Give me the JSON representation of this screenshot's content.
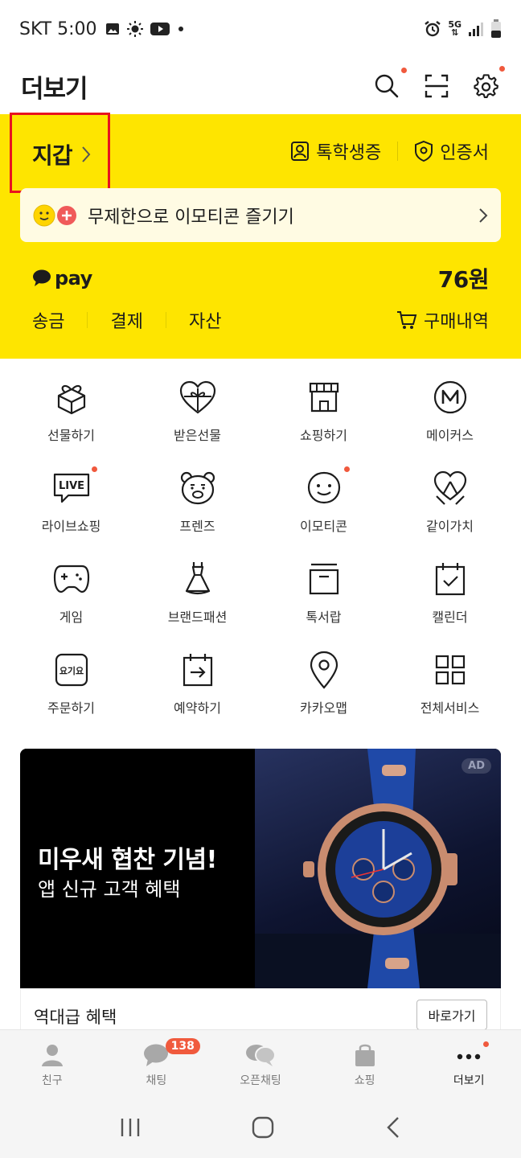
{
  "status_bar": {
    "carrier_time": "SKT 5:00",
    "network": "5G"
  },
  "header": {
    "title": "더보기"
  },
  "wallet": {
    "title": "지갑",
    "links": [
      {
        "label": "톡학생증",
        "icon": "student-id-icon"
      },
      {
        "label": "인증서",
        "icon": "certificate-icon"
      }
    ],
    "emoticon_banner": "무제한으로 이모티콘 즐기기",
    "pay": {
      "logo_text": "pay",
      "amount": "76원"
    },
    "pay_menu": [
      "송금",
      "결제",
      "자산"
    ],
    "purchase_history": "구매내역"
  },
  "services": [
    {
      "label": "선물하기",
      "icon": "gift-box-icon"
    },
    {
      "label": "받은선물",
      "icon": "received-gift-icon"
    },
    {
      "label": "쇼핑하기",
      "icon": "store-icon"
    },
    {
      "label": "메이커스",
      "icon": "makers-icon"
    },
    {
      "label": "라이브쇼핑",
      "icon": "live-icon"
    },
    {
      "label": "프렌즈",
      "icon": "friends-bear-icon"
    },
    {
      "label": "이모티콘",
      "icon": "emoticon-icon"
    },
    {
      "label": "같이가치",
      "icon": "heart-ribbon-icon"
    },
    {
      "label": "게임",
      "icon": "gamepad-icon"
    },
    {
      "label": "브랜드패션",
      "icon": "dress-icon"
    },
    {
      "label": "톡서랍",
      "icon": "drawer-icon"
    },
    {
      "label": "캘린더",
      "icon": "calendar-icon"
    },
    {
      "label": "주문하기",
      "icon": "order-icon",
      "icon_text": "요기요"
    },
    {
      "label": "예약하기",
      "icon": "reservation-icon"
    },
    {
      "label": "카카오맵",
      "icon": "map-pin-icon"
    },
    {
      "label": "전체서비스",
      "icon": "all-services-icon"
    }
  ],
  "ad": {
    "headline": "미우새  협찬 기념!",
    "subline": "앱 신규 고객 혜택",
    "badge": "AD",
    "caption": "역대급 혜택",
    "cta": "바로가기"
  },
  "tabs": [
    {
      "label": "친구",
      "icon": "person-icon"
    },
    {
      "label": "채팅",
      "icon": "chat-icon",
      "badge": "138"
    },
    {
      "label": "오픈채팅",
      "icon": "open-chat-icon"
    },
    {
      "label": "쇼핑",
      "icon": "shopping-bag-icon"
    },
    {
      "label": "더보기",
      "icon": "more-icon"
    }
  ],
  "colors": {
    "kakao_yellow": "#fee500",
    "notification_red": "#f05a3d",
    "highlight_red": "#e8131f"
  }
}
